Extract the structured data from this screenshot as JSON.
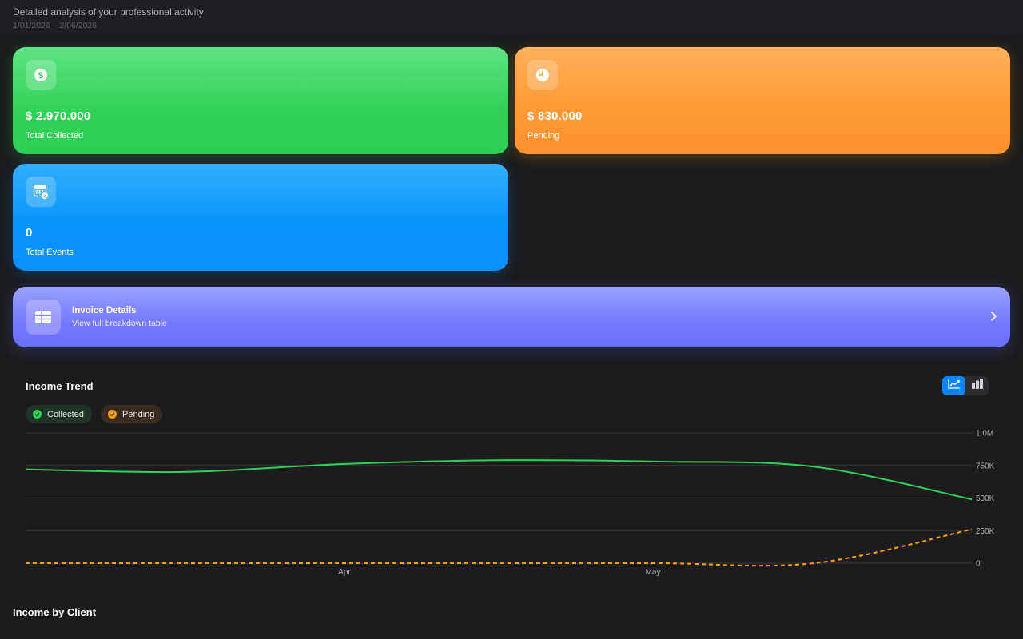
{
  "header": {
    "subtitle": "Detailed analysis of your professional activity",
    "date_range": "1/01/2026 – 2/06/2026"
  },
  "cards": {
    "collected": {
      "value": "$ 2.970.000",
      "label": "Total Collected",
      "icon": "dollar-icon",
      "color": "#30d158"
    },
    "pending": {
      "value": "$ 830.000",
      "label": "Pending",
      "icon": "clock-icon",
      "color": "#ff9f0a"
    },
    "events": {
      "value": "0",
      "label": "Total Events",
      "icon": "calendar-icon",
      "color": "#0a84ff"
    }
  },
  "invoice": {
    "title": "Invoice Details",
    "subtitle": "View full breakdown table",
    "icon": "table-icon",
    "color": "#7378ff"
  },
  "trend": {
    "title": "Income Trend",
    "view_modes": [
      "line-chart-icon",
      "bar-chart-icon"
    ],
    "active_view": "line",
    "legend": [
      {
        "label": "Collected",
        "color": "#30d158"
      },
      {
        "label": "Pending",
        "color": "#ff9f0a"
      }
    ]
  },
  "chart_data": {
    "type": "line",
    "x": [
      "2026-03-01",
      "2026-03-16",
      "2026-04-01",
      "2026-04-16",
      "2026-05-01",
      "2026-05-16",
      "2026-06-01"
    ],
    "series": [
      {
        "name": "Collected",
        "values": [
          720000,
          700000,
          760000,
          790000,
          780000,
          740000,
          490000
        ],
        "color": "#30d158",
        "style": "solid"
      },
      {
        "name": "Pending",
        "values": [
          0,
          0,
          0,
          0,
          0,
          0,
          260000
        ],
        "color": "#ff9f0a",
        "style": "dashed"
      }
    ],
    "xticks": [
      "Apr",
      "May"
    ],
    "yticks": [
      "0",
      "250K",
      "500K",
      "750K",
      "1.0M"
    ],
    "ylim": [
      0,
      1000000
    ],
    "grid": true,
    "y_axis_side": "right"
  },
  "clients": {
    "title": "Income by Client"
  }
}
